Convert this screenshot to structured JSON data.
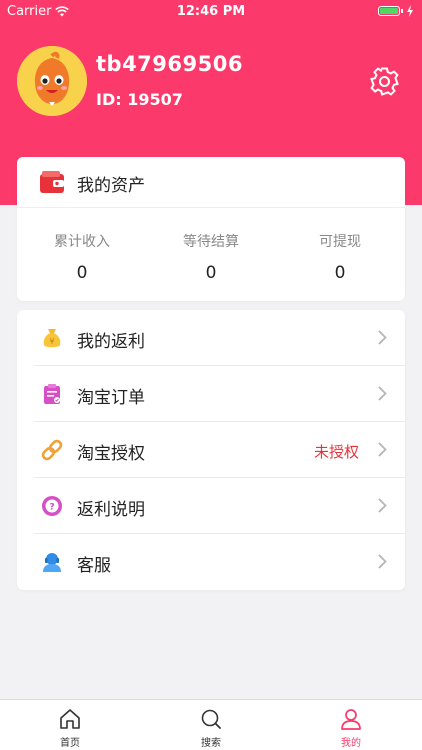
{
  "status_bar": {
    "carrier": "Carrier",
    "time": "12:46 PM"
  },
  "profile": {
    "username": "tb47969506",
    "user_id": "ID: 19507"
  },
  "assets": {
    "title": "我的资产",
    "stats": [
      {
        "label": "累计收入",
        "value": "0"
      },
      {
        "label": "等待结算",
        "value": "0"
      },
      {
        "label": "可提现",
        "value": "0"
      }
    ]
  },
  "menu": {
    "items": [
      {
        "label": "我的返利",
        "icon": "money-bag-icon"
      },
      {
        "label": "淘宝订单",
        "icon": "clipboard-icon"
      },
      {
        "label": "淘宝授权",
        "icon": "link-icon",
        "status": "未授权"
      },
      {
        "label": "返利说明",
        "icon": "question-icon"
      },
      {
        "label": "客服",
        "icon": "customer-service-icon"
      }
    ]
  },
  "tabbar": {
    "tabs": [
      {
        "label": "首页",
        "icon": "home-icon"
      },
      {
        "label": "搜索",
        "icon": "search-icon"
      },
      {
        "label": "我的",
        "icon": "user-icon",
        "active": true
      }
    ]
  },
  "colors": {
    "brand": "#fb3a6b",
    "status_red": "#e8323a"
  }
}
